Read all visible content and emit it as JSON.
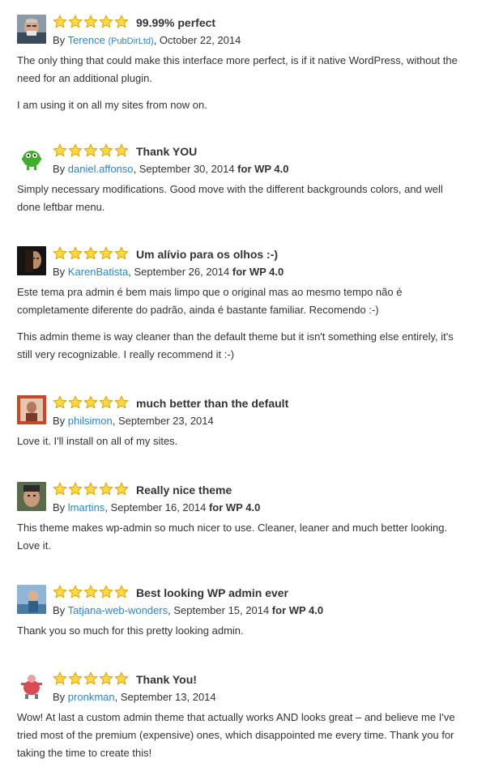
{
  "reviews": [
    {
      "stars": 5,
      "title": "99.99% perfect",
      "by_prefix": "By ",
      "author": "Terence",
      "company": "(PubDirLtd)",
      "date": ", October 22, 2014",
      "version": "",
      "paragraphs": [
        "The only thing that could make this interface more perfect, is if it native WordPress, without the need for an additional plugin.",
        "I am using it on all my sites from now on."
      ]
    },
    {
      "stars": 5,
      "title": "Thank YOU",
      "by_prefix": "By ",
      "author": "daniel.affonso",
      "company": "",
      "date": ", September 30, 2014 ",
      "version": "for WP 4.0",
      "paragraphs": [
        "Simply necessary modifications. Good move with the different backgrounds colors, and well done leftbar menu."
      ]
    },
    {
      "stars": 5,
      "title": "Um alívio para os olhos :-)",
      "by_prefix": "By ",
      "author": "KarenBatista",
      "company": "",
      "date": ", September 26, 2014 ",
      "version": "for WP 4.0",
      "paragraphs": [
        "Este tema pra admin é bem mais limpo que o original mas ao mesmo tempo não é completamente diferente do padrão, ainda é bastante familiar. Recomendo :-)",
        "This admin theme is way cleaner than the default theme but it isn't something else entirely, it's still very recognizable. I really recommend it :-)"
      ]
    },
    {
      "stars": 5,
      "title": "much better than the default",
      "by_prefix": "By ",
      "author": "philsimon",
      "company": "",
      "date": ", September 23, 2014",
      "version": "",
      "paragraphs": [
        "Love it. I'll install on all of my sites."
      ]
    },
    {
      "stars": 5,
      "title": "Really nice theme",
      "by_prefix": "By ",
      "author": "lmartins",
      "company": "",
      "date": ", September 16, 2014 ",
      "version": "for WP 4.0",
      "paragraphs": [
        "This theme makes wp-admin so much nicer to use. Cleaner, leaner and much better looking. Love it."
      ]
    },
    {
      "stars": 5,
      "title": "Best looking WP admin ever",
      "by_prefix": "By ",
      "author": "Tatjana-web-wonders",
      "company": "",
      "date": ", September 15, 2014 ",
      "version": "for WP 4.0",
      "paragraphs": [
        "Thank you so much for this pretty looking admin."
      ]
    },
    {
      "stars": 5,
      "title": "Thank You!",
      "by_prefix": "By ",
      "author": "pronkman",
      "company": "",
      "date": ", September 13, 2014",
      "version": "",
      "paragraphs": [
        "Wow! At last a custom admin theme that actually works AND looks great – and believe me I've tried most of the premium (expensive) ones, which disappointed me every time. Thank you for taking the time to create this!"
      ]
    }
  ],
  "colors": {
    "link": "#2e85c3",
    "star_fill": "#ffd84a",
    "star_stroke": "#d9a300",
    "text": "#333333"
  }
}
